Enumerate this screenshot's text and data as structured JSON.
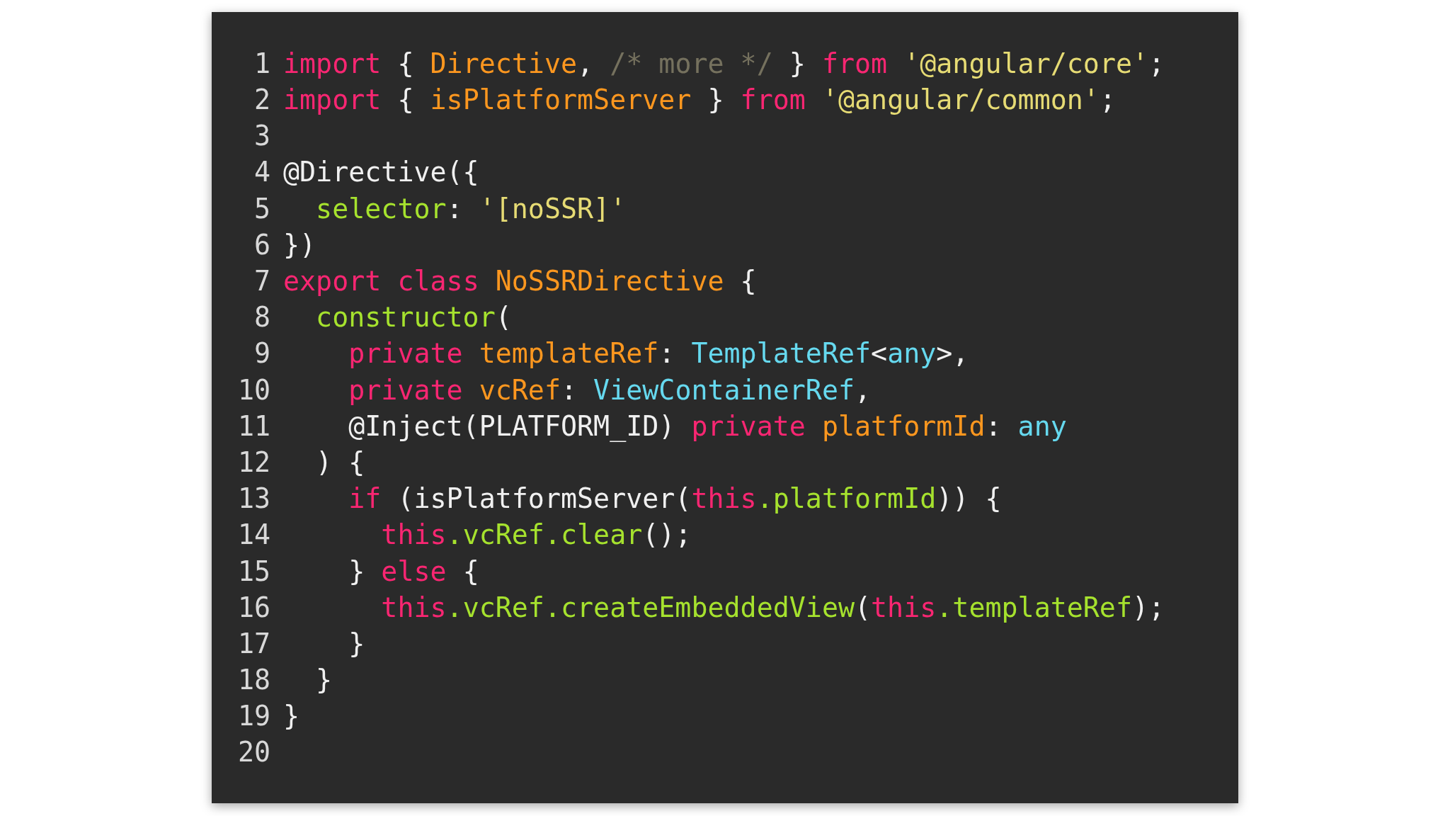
{
  "code_lines": [
    {
      "number": "1",
      "tokens": [
        {
          "kind": "keyword",
          "text": "import"
        },
        {
          "kind": "plain",
          "text": " { "
        },
        {
          "kind": "entity",
          "text": "Directive"
        },
        {
          "kind": "plain",
          "text": ", "
        },
        {
          "kind": "comment",
          "text": "/* more */"
        },
        {
          "kind": "plain",
          "text": " } "
        },
        {
          "kind": "keyword",
          "text": "from"
        },
        {
          "kind": "string",
          "text": " '@angular/core'"
        },
        {
          "kind": "plain",
          "text": ";"
        }
      ]
    },
    {
      "number": "2",
      "tokens": [
        {
          "kind": "keyword",
          "text": "import"
        },
        {
          "kind": "plain",
          "text": " { "
        },
        {
          "kind": "entity",
          "text": "isPlatformServer"
        },
        {
          "kind": "plain",
          "text": " } "
        },
        {
          "kind": "keyword",
          "text": "from"
        },
        {
          "kind": "string",
          "text": " '@angular/common'"
        },
        {
          "kind": "plain",
          "text": ";"
        }
      ]
    },
    {
      "number": "3"
    },
    {
      "number": "4",
      "tokens": [
        {
          "kind": "plain",
          "text": "@Directive({"
        }
      ]
    },
    {
      "number": "5",
      "tokens": [
        {
          "kind": "member",
          "text": "  selector"
        },
        {
          "kind": "plain",
          "text": ": "
        },
        {
          "kind": "string",
          "text": "'[noSSR]'"
        }
      ]
    },
    {
      "number": "6",
      "tokens": [
        {
          "kind": "plain",
          "text": "})"
        }
      ]
    },
    {
      "number": "7",
      "tokens": [
        {
          "kind": "keyword",
          "text": "export"
        },
        {
          "kind": "keyword",
          "text": " class"
        },
        {
          "kind": "entity",
          "text": " NoSSRDirective"
        },
        {
          "kind": "plain",
          "text": " {"
        }
      ]
    },
    {
      "number": "8",
      "tokens": [
        {
          "kind": "member",
          "text": "  constructor"
        },
        {
          "kind": "plain",
          "text": "("
        }
      ]
    },
    {
      "number": "9",
      "tokens": [
        {
          "kind": "keyword",
          "text": "    private"
        },
        {
          "kind": "entity",
          "text": " templateRef"
        },
        {
          "kind": "plain",
          "text": ": "
        },
        {
          "kind": "type",
          "text": "TemplateRef"
        },
        {
          "kind": "plain",
          "text": "<"
        },
        {
          "kind": "type",
          "text": "any"
        },
        {
          "kind": "plain",
          "text": ">,"
        }
      ]
    },
    {
      "number": "10",
      "tokens": [
        {
          "kind": "keyword",
          "text": "    private"
        },
        {
          "kind": "entity",
          "text": " vcRef"
        },
        {
          "kind": "plain",
          "text": ": "
        },
        {
          "kind": "type",
          "text": "ViewContainerRef"
        },
        {
          "kind": "plain",
          "text": ","
        }
      ]
    },
    {
      "number": "11",
      "tokens": [
        {
          "kind": "plain",
          "text": "    @Inject(PLATFORM_ID) "
        },
        {
          "kind": "keyword",
          "text": "private"
        },
        {
          "kind": "entity",
          "text": " platformId"
        },
        {
          "kind": "plain",
          "text": ": "
        },
        {
          "kind": "type",
          "text": "any"
        }
      ]
    },
    {
      "number": "12",
      "tokens": [
        {
          "kind": "plain",
          "text": "  ) {"
        }
      ]
    },
    {
      "number": "13",
      "tokens": [
        {
          "kind": "keyword",
          "text": "    if"
        },
        {
          "kind": "plain",
          "text": " (isPlatformServer("
        },
        {
          "kind": "keyword",
          "text": "this"
        },
        {
          "kind": "member",
          "text": ".platformId"
        },
        {
          "kind": "plain",
          "text": ")) {"
        }
      ]
    },
    {
      "number": "14",
      "tokens": [
        {
          "kind": "keyword",
          "text": "      this"
        },
        {
          "kind": "member",
          "text": ".vcRef.clear"
        },
        {
          "kind": "plain",
          "text": "();"
        }
      ]
    },
    {
      "number": "15",
      "tokens": [
        {
          "kind": "plain",
          "text": "    } "
        },
        {
          "kind": "keyword",
          "text": "else"
        },
        {
          "kind": "plain",
          "text": " {"
        }
      ]
    },
    {
      "number": "16",
      "tokens": [
        {
          "kind": "keyword",
          "text": "      this"
        },
        {
          "kind": "member",
          "text": ".vcRef.createEmbeddedView"
        },
        {
          "kind": "plain",
          "text": "("
        },
        {
          "kind": "keyword",
          "text": "this"
        },
        {
          "kind": "member",
          "text": ".templateRef"
        },
        {
          "kind": "plain",
          "text": ");"
        }
      ]
    },
    {
      "number": "17",
      "tokens": [
        {
          "kind": "plain",
          "text": "    }"
        }
      ]
    },
    {
      "number": "18",
      "tokens": [
        {
          "kind": "plain",
          "text": "  }"
        }
      ]
    },
    {
      "number": "19",
      "tokens": [
        {
          "kind": "plain",
          "text": "}"
        }
      ]
    },
    {
      "number": "20"
    }
  ]
}
